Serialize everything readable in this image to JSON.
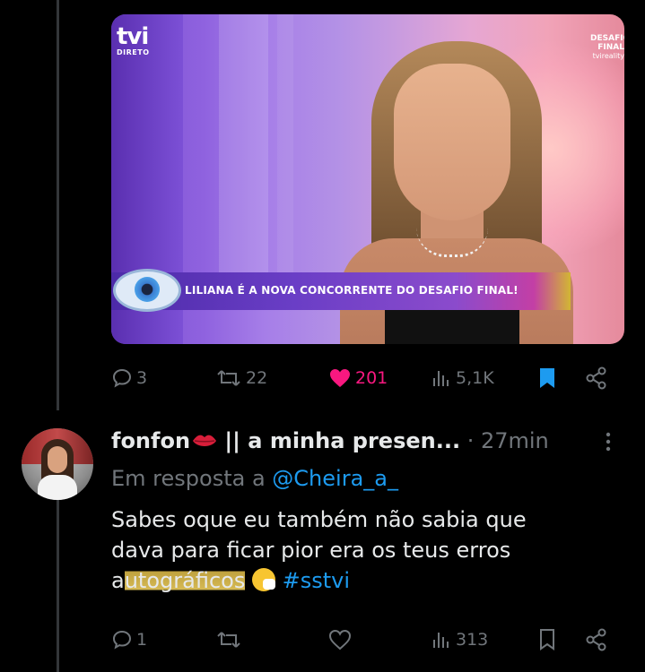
{
  "media": {
    "channel_logo": "tvi",
    "channel_live": "DIRETO",
    "corner_logo_line1": "DESAFIO",
    "corner_logo_line2": "FINAL",
    "corner_logo_line3": "tvireality",
    "banner_text": "LILIANA É A NOVA CONCORRENTE DO DESAFIO FINAL!"
  },
  "main_actions": {
    "replies": "3",
    "retweets": "22",
    "likes": "201",
    "views": "5,1K",
    "icons": [
      "reply-icon",
      "retweet-icon",
      "like-icon-filled",
      "views-icon",
      "bookmark-icon-filled",
      "share-icon"
    ]
  },
  "reply": {
    "display_name": "fonfon",
    "name_suffix": " || a minha presen...",
    "time": " · 27min",
    "reply_prefix": "Em resposta a ",
    "reply_handle": "@Cheira_a_",
    "text_line1": "Sabes oque eu também não sabia que",
    "text_line2": "dava para ficar pior era os teus erros",
    "text_line3_pre": "a",
    "text_line3_highlight": "utográficos",
    "hashtag": "#sstvi",
    "actions": {
      "replies": "1",
      "views": "313"
    }
  },
  "colors": {
    "background": "#000000",
    "muted": "#71767b",
    "text": "#e7e9ea",
    "accent": "#1d9bf0",
    "like": "#f91880",
    "highlight": "#c8a94a"
  }
}
